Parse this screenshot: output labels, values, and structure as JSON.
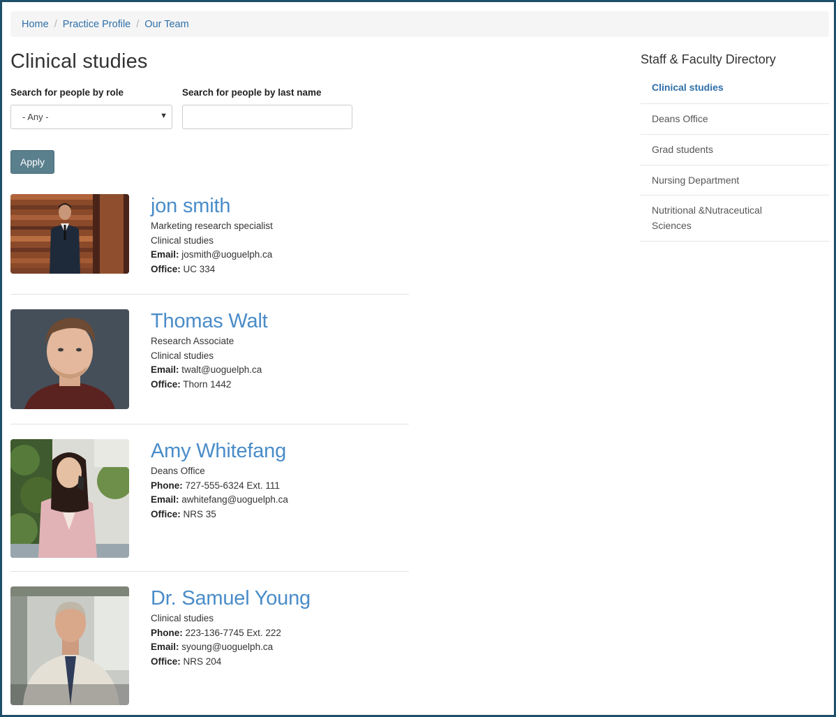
{
  "breadcrumb": {
    "items": [
      "Home",
      "Practice Profile",
      "Our Team"
    ],
    "separator": "/"
  },
  "page_title": "Clinical studies",
  "filters": {
    "role_label": "Search for people by role",
    "role_value": "- Any -",
    "lastname_label": "Search for people by last name",
    "lastname_value": "",
    "apply_label": "Apply"
  },
  "people": [
    {
      "name": "jon smith",
      "role": "Marketing research specialist",
      "department": "Clinical studies",
      "email_label": "Email:",
      "email": "josmith@uoguelph.ca",
      "office_label": "Office:",
      "office": "UC 334"
    },
    {
      "name": "Thomas Walt",
      "role": "Research Associate",
      "department": "Clinical studies",
      "email_label": "Email:",
      "email": "twalt@uoguelph.ca",
      "office_label": "Office:",
      "office": "Thorn 1442"
    },
    {
      "name": "Amy Whitefang",
      "department": "Deans Office",
      "phone_label": "Phone:",
      "phone": "727-555-6324 Ext. 111",
      "email_label": "Email:",
      "email": "awhitefang@uoguelph.ca",
      "office_label": "Office:",
      "office": "NRS 35"
    },
    {
      "name": "Dr. Samuel Young",
      "department": "Clinical studies",
      "phone_label": "Phone:",
      "phone": "223-136-7745 Ext. 222",
      "email_label": "Email:",
      "email": "syoung@uoguelph.ca",
      "office_label": "Office:",
      "office": "NRS 204"
    }
  ],
  "sidebar": {
    "title": "Staff & Faculty Directory",
    "items": [
      {
        "label": "Clinical studies",
        "active": true
      },
      {
        "label": "Deans Office",
        "active": false
      },
      {
        "label": "Grad students",
        "active": false
      },
      {
        "label": "Nursing Department",
        "active": false
      },
      {
        "label": "Nutritional &Nutraceutical Sciences",
        "active": false
      }
    ]
  },
  "colors": {
    "frame_border": "#1f4e6b",
    "link": "#2f6fa8",
    "name": "#4a8cc8",
    "apply_button": "#5a7f8d"
  }
}
